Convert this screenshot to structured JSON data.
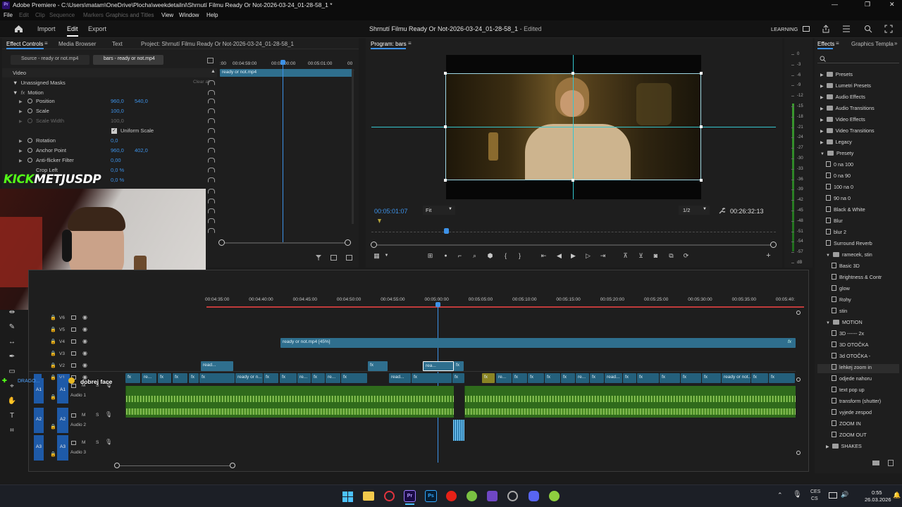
{
  "window": {
    "title": "Adobe Premiere - C:\\Users\\matam\\OneDrive\\Plocha\\weekdetailni\\Shrnutí Filmu Ready Or Not-2026-03-24_01-28-58_1 *",
    "minimize": "—",
    "maximize": "❐",
    "close": "✕"
  },
  "menu": [
    "File",
    "Edit",
    "Clip",
    "Sequence",
    "Markers",
    "Graphics and Titles",
    "View",
    "Window",
    "Help"
  ],
  "header": {
    "nav": [
      "Import",
      "Edit",
      "Export"
    ],
    "active": "Edit",
    "project_title": "Shrnutí Filmu Ready Or Not-2026-03-24_01-28-58_1",
    "edited": " - Edited",
    "workspace": "LEARNING"
  },
  "effect_controls": {
    "tabs": [
      "Effect Controls",
      "Media Browser",
      "Text",
      "Project: Shrnutí Filmu Ready Or Not-2026-03-24_01-28-58_1"
    ],
    "source": "Source - ready or not.mp4",
    "sequence": "bars - ready or not.mp4",
    "section_video": "Video",
    "unassigned": "Unassigned Masks",
    "clear_all": "Clear all",
    "motion": "Motion",
    "props": [
      {
        "label": "Position",
        "v1": "960,0",
        "v2": "540,0"
      },
      {
        "label": "Scale",
        "v1": "100,0",
        "v2": ""
      },
      {
        "label": "Scale Width",
        "v1": "100,0",
        "v2": ""
      },
      {
        "label": "Uniform Scale",
        "v1": "",
        "v2": ""
      },
      {
        "label": "Rotation",
        "v1": "0,0",
        "v2": ""
      },
      {
        "label": "Anchor Point",
        "v1": "960,0",
        "v2": "402,0"
      },
      {
        "label": "Anti-flicker Filter",
        "v1": "0,00",
        "v2": ""
      },
      {
        "label": "Crop Left",
        "v1": "0,0 %",
        "v2": ""
      },
      {
        "label": "",
        "v1": "0,0 %",
        "v2": ""
      }
    ],
    "ruler": [
      "00:04:59:00",
      "00:05:00:00",
      "00:05:01:00"
    ],
    "clip_name": "ready or not.mp4"
  },
  "program": {
    "title": "Program: bars",
    "timecode": "00:05:01:07",
    "fit": "Fit",
    "resolution": "1/2",
    "duration": "00:26:32:13"
  },
  "meter": [
    "0",
    "-3",
    "-6",
    "-9",
    "-12",
    "-15",
    "-18",
    "-21",
    "-24",
    "-27",
    "-30",
    "-33",
    "-36",
    "-39",
    "-42",
    "-45",
    "-48",
    "-51",
    "-54",
    "-57",
    "dB"
  ],
  "effects": {
    "tab": "Effects",
    "tab2": "Graphics Templa",
    "items": [
      {
        "label": "Presets",
        "kind": "folder",
        "level": 0
      },
      {
        "label": "Lumetri Presets",
        "kind": "folder",
        "level": 0
      },
      {
        "label": "Audio Effects",
        "kind": "folder",
        "level": 0
      },
      {
        "label": "Audio Transitions",
        "kind": "folder",
        "level": 0
      },
      {
        "label": "Video Effects",
        "kind": "folder",
        "level": 0
      },
      {
        "label": "Video Transitions",
        "kind": "folder",
        "level": 0
      },
      {
        "label": "Legacy",
        "kind": "folder",
        "level": 0
      },
      {
        "label": "Presety",
        "kind": "folder",
        "level": 0
      },
      {
        "label": "0 na 100",
        "kind": "preset",
        "level": 1
      },
      {
        "label": "0 na 90",
        "kind": "preset",
        "level": 1
      },
      {
        "label": "100 na 0",
        "kind": "preset",
        "level": 1
      },
      {
        "label": "90 na 0",
        "kind": "preset",
        "level": 1
      },
      {
        "label": "Black & White",
        "kind": "preset",
        "level": 1
      },
      {
        "label": "Blur",
        "kind": "preset",
        "level": 1
      },
      {
        "label": "blur 2",
        "kind": "preset",
        "level": 1
      },
      {
        "label": "Surround Reverb",
        "kind": "preset",
        "level": 1
      },
      {
        "label": "ramecek, stin",
        "kind": "folder",
        "level": 1
      },
      {
        "label": "Basic 3D",
        "kind": "preset",
        "level": 2
      },
      {
        "label": "Brightness & Contr",
        "kind": "preset",
        "level": 2
      },
      {
        "label": "glow",
        "kind": "preset",
        "level": 2
      },
      {
        "label": "Rohy",
        "kind": "preset",
        "level": 2
      },
      {
        "label": "stin",
        "kind": "preset",
        "level": 2
      },
      {
        "label": "MOTION",
        "kind": "folder",
        "level": 1
      },
      {
        "label": "3D ------ 2x",
        "kind": "preset",
        "level": 2
      },
      {
        "label": "3D OTOČKA",
        "kind": "preset",
        "level": 2
      },
      {
        "label": "3d OTOČKA -",
        "kind": "preset",
        "level": 2
      },
      {
        "label": "lehkej zoom in",
        "kind": "preset",
        "level": 2
      },
      {
        "label": "odjede nahoru",
        "kind": "preset",
        "level": 2
      },
      {
        "label": "text pop up",
        "kind": "preset",
        "level": 2
      },
      {
        "label": "transform (shutter)",
        "kind": "preset",
        "level": 2
      },
      {
        "label": "vyjede zespod",
        "kind": "preset",
        "level": 2
      },
      {
        "label": "ZOOM IN",
        "kind": "preset",
        "level": 2
      },
      {
        "label": "ZOOM OUT",
        "kind": "preset",
        "level": 2
      },
      {
        "label": "SHAKES",
        "kind": "folder",
        "level": 1
      }
    ],
    "selected": "lehkej zoom in"
  },
  "webcam": {
    "overlay": "KICK METJUSDP",
    "kick": "KICK",
    "name": "METJUSDP",
    "badge_user": "DRAGO...",
    "badge_msg": "dobrej face"
  },
  "timeline": {
    "ruler": [
      "00:04:35:00",
      "00:04:40:00",
      "00:04:45:00",
      "00:04:50:00",
      "00:04:55:00",
      "00:05:00:00",
      "00:05:05:00",
      "00:05:10:00",
      "00:05:15:00",
      "00:05:20:00",
      "00:05:25:00",
      "00:05:30:00",
      "00:05:35:00",
      "00:05:40:"
    ],
    "tracks_v": [
      "V6",
      "V5",
      "V4",
      "V3",
      "V2",
      "V1"
    ],
    "tracks_a": [
      {
        "id": "A1",
        "name": "Audio 1"
      },
      {
        "id": "A2",
        "name": "Audio 2"
      },
      {
        "id": "A3",
        "name": "Audio 3"
      }
    ],
    "v4_clip": "ready or not.mp4 [45%]",
    "fx": "fx",
    "read": "read...",
    "ready_or_n": "ready or n...",
    "ready_or_not": "ready or not...",
    "re": "re...",
    "rea": "rea...",
    "m": "M",
    "s": "S"
  },
  "taskbar": {
    "lang1": "CES",
    "lang2": "CS",
    "time": "0:55",
    "date": "26.03.2026"
  },
  "colors": {
    "accent": "#3d92e8",
    "clip_video": "#2f6f8e",
    "clip_audio": "#2f6a1c",
    "playhead": "#3d92e8",
    "track_blue": "#1e5aa8"
  }
}
